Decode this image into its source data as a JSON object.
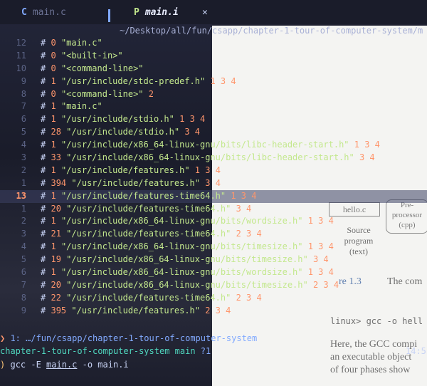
{
  "tabs": [
    {
      "icon": "C",
      "label": "main.c",
      "active": false
    },
    {
      "icon": "P",
      "label": "main.i",
      "active": true,
      "close": "✕"
    }
  ],
  "path": "~/Desktop/all/fun/csapp/chapter-1-tour-of-computer-system/m",
  "lines": [
    {
      "n": "12",
      "hash": "#",
      "num": "0",
      "str": "\"main.c\"",
      "flags": ""
    },
    {
      "n": "11",
      "hash": "#",
      "num": "0",
      "str": "\"<built-in>\"",
      "flags": ""
    },
    {
      "n": "10",
      "hash": "#",
      "num": "0",
      "str": "\"<command-line>\"",
      "flags": ""
    },
    {
      "n": "9",
      "hash": "#",
      "num": "1",
      "str": "\"/usr/include/stdc-predef.h\"",
      "flags": "1 3 4"
    },
    {
      "n": "8",
      "hash": "#",
      "num": "0",
      "str": "\"<command-line>\"",
      "flags": "2"
    },
    {
      "n": "7",
      "hash": "#",
      "num": "1",
      "str": "\"main.c\"",
      "flags": ""
    },
    {
      "n": "6",
      "hash": "#",
      "num": "1",
      "str": "\"/usr/include/stdio.h\"",
      "flags": "1 3 4"
    },
    {
      "n": "5",
      "hash": "#",
      "num": "28",
      "str": "\"/usr/include/stdio.h\"",
      "flags": "3 4"
    },
    {
      "n": "4",
      "hash": "#",
      "num": "1",
      "str": "\"/usr/include/x86_64-linux-gnu/bits/libc-header-start.h\"",
      "flags": "1 3 4"
    },
    {
      "n": "3",
      "hash": "#",
      "num": "33",
      "str": "\"/usr/include/x86_64-linux-gnu/bits/libc-header-start.h\"",
      "flags": "3 4"
    },
    {
      "n": "2",
      "hash": "#",
      "num": "1",
      "str": "\"/usr/include/features.h\"",
      "flags": "1 3 4"
    },
    {
      "n": "1",
      "hash": "#",
      "num": "394",
      "str": "\"/usr/include/features.h\"",
      "flags": "3 4"
    },
    {
      "n": "13",
      "hash": "#",
      "num": "1",
      "str": "\"/usr/include/features-time64.h\"",
      "flags": "1 3 4",
      "current": true
    },
    {
      "n": "1",
      "hash": "#",
      "num": "20",
      "str": "\"/usr/include/features-time64.h\"",
      "flags": "3 4"
    },
    {
      "n": "2",
      "hash": "#",
      "num": "1",
      "str": "\"/usr/include/x86_64-linux-gnu/bits/wordsize.h\"",
      "flags": "1 3 4"
    },
    {
      "n": "3",
      "hash": "#",
      "num": "21",
      "str": "\"/usr/include/features-time64.h\"",
      "flags": "2 3 4"
    },
    {
      "n": "4",
      "hash": "#",
      "num": "1",
      "str": "\"/usr/include/x86_64-linux-gnu/bits/timesize.h\"",
      "flags": "1 3 4"
    },
    {
      "n": "5",
      "hash": "#",
      "num": "19",
      "str": "\"/usr/include/x86_64-linux-gnu/bits/timesize.h\"",
      "flags": "3 4"
    },
    {
      "n": "6",
      "hash": "#",
      "num": "1",
      "str": "\"/usr/include/x86_64-linux-gnu/bits/wordsize.h\"",
      "flags": "1 3 4"
    },
    {
      "n": "7",
      "hash": "#",
      "num": "20",
      "str": "\"/usr/include/x86_64-linux-gnu/bits/timesize.h\"",
      "flags": "2 3 4"
    },
    {
      "n": "8",
      "hash": "#",
      "num": "22",
      "str": "\"/usr/include/features-time64.h\"",
      "flags": "2 3 4"
    },
    {
      "n": "9",
      "hash": "#",
      "num": "395",
      "str": "\"/usr/include/features.h\"",
      "flags": "2 3 4"
    }
  ],
  "terminal": {
    "line1_chev": "❯",
    "line1": " 1: …/fun/csapp/chapter-1-tour-of-computer-system",
    "line2_dir": "chapter-1-tour-of-computer-system",
    "line2_branch": "main",
    "line2_status": "?1",
    "line2_time": "14:5",
    "line3_prompt": ")",
    "line3_cmd": "gcc -E ",
    "line3_arg": "main.c",
    "line3_rest": " -o main.i"
  },
  "background": {
    "box1": "hello.c",
    "box2": "Pre-processor (cpp)",
    "box3": "Source program (text)",
    "caption_num": "re 1.3",
    "caption": "The com",
    "code": "linux> gcc -o hell",
    "para1": "Here, the GCC compi",
    "para2": "an executable object",
    "para3": "of four phases show"
  }
}
